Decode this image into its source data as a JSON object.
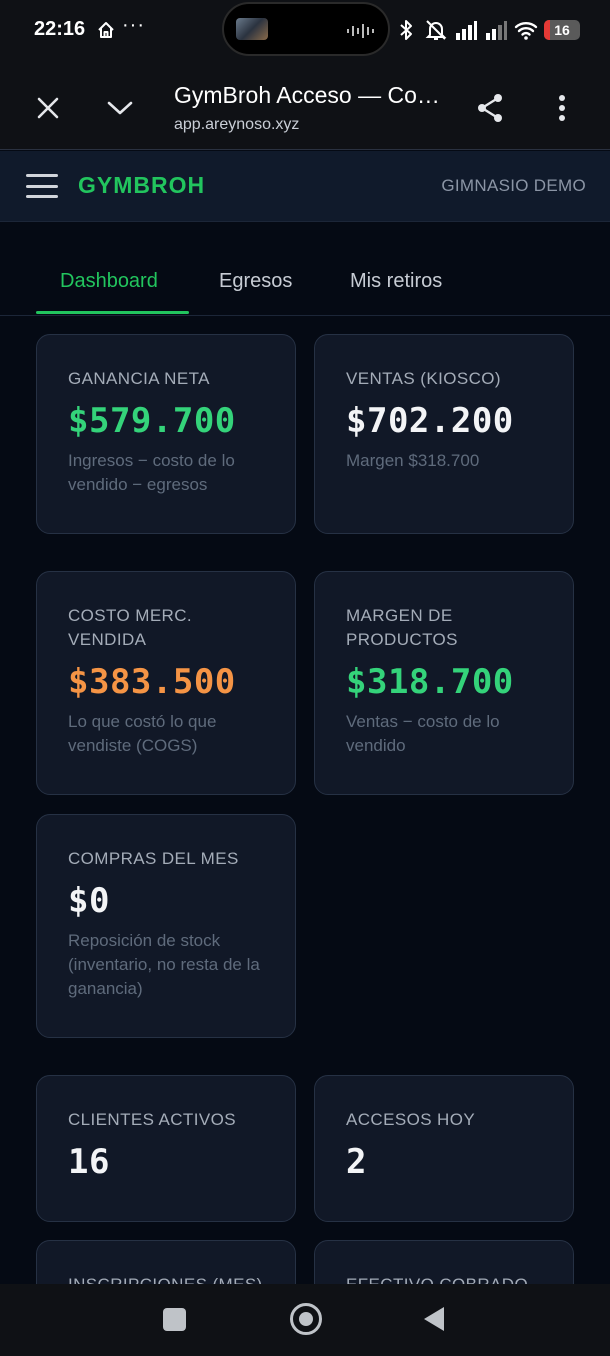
{
  "status_bar": {
    "time": "22:16",
    "more": "···",
    "battery_level": "16",
    "battery_fraction": 0.16
  },
  "browser": {
    "title": "GymBroh Acceso — Control",
    "url": "app.areynoso.xyz"
  },
  "app": {
    "brand": "GYMBROH",
    "gym_name": "GIMNASIO DEMO"
  },
  "tabs": [
    {
      "label": "Dashboard",
      "active": true
    },
    {
      "label": "Egresos",
      "active": false
    },
    {
      "label": "Mis retiros",
      "active": false
    }
  ],
  "cards": {
    "ganancia": {
      "label": "GANANCIA NETA",
      "value": "$579.700",
      "sub": "Ingresos − costo de lo vendido − egresos"
    },
    "ventas": {
      "label": "VENTAS (KIOSCO)",
      "value": "$702.200",
      "sub": "Margen $318.700"
    },
    "costo": {
      "label": "COSTO MERC. VENDIDA",
      "value": "$383.500",
      "sub": "Lo que costó lo que vendiste (COGS)"
    },
    "margen": {
      "label": "MARGEN DE PRODUCTOS",
      "value": "$318.700",
      "sub": "Ventas − costo de lo vendido"
    },
    "compras": {
      "label": "COMPRAS DEL MES",
      "value": "$0",
      "sub": "Reposición de stock (inventario, no resta de la ganancia)"
    },
    "clientes": {
      "label": "CLIENTES ACTIVOS",
      "value": "16"
    },
    "accesos": {
      "label": "ACCESOS HOY",
      "value": "2"
    },
    "inscripciones": {
      "label": "INSCRIPCIONES (MES)"
    },
    "efectivo": {
      "label": "EFECTIVO COBRADO"
    }
  },
  "colors": {
    "accent": "#22c55e",
    "positive": "#34d37a",
    "warning": "#f59445",
    "card_bg": "#111827",
    "page_bg": "#050a14"
  },
  "icons": {
    "home": "home-icon",
    "close": "close-icon",
    "chevron": "chevron-down-icon",
    "share": "share-icon",
    "more": "more-vert-icon",
    "menu": "hamburger-menu-icon"
  }
}
